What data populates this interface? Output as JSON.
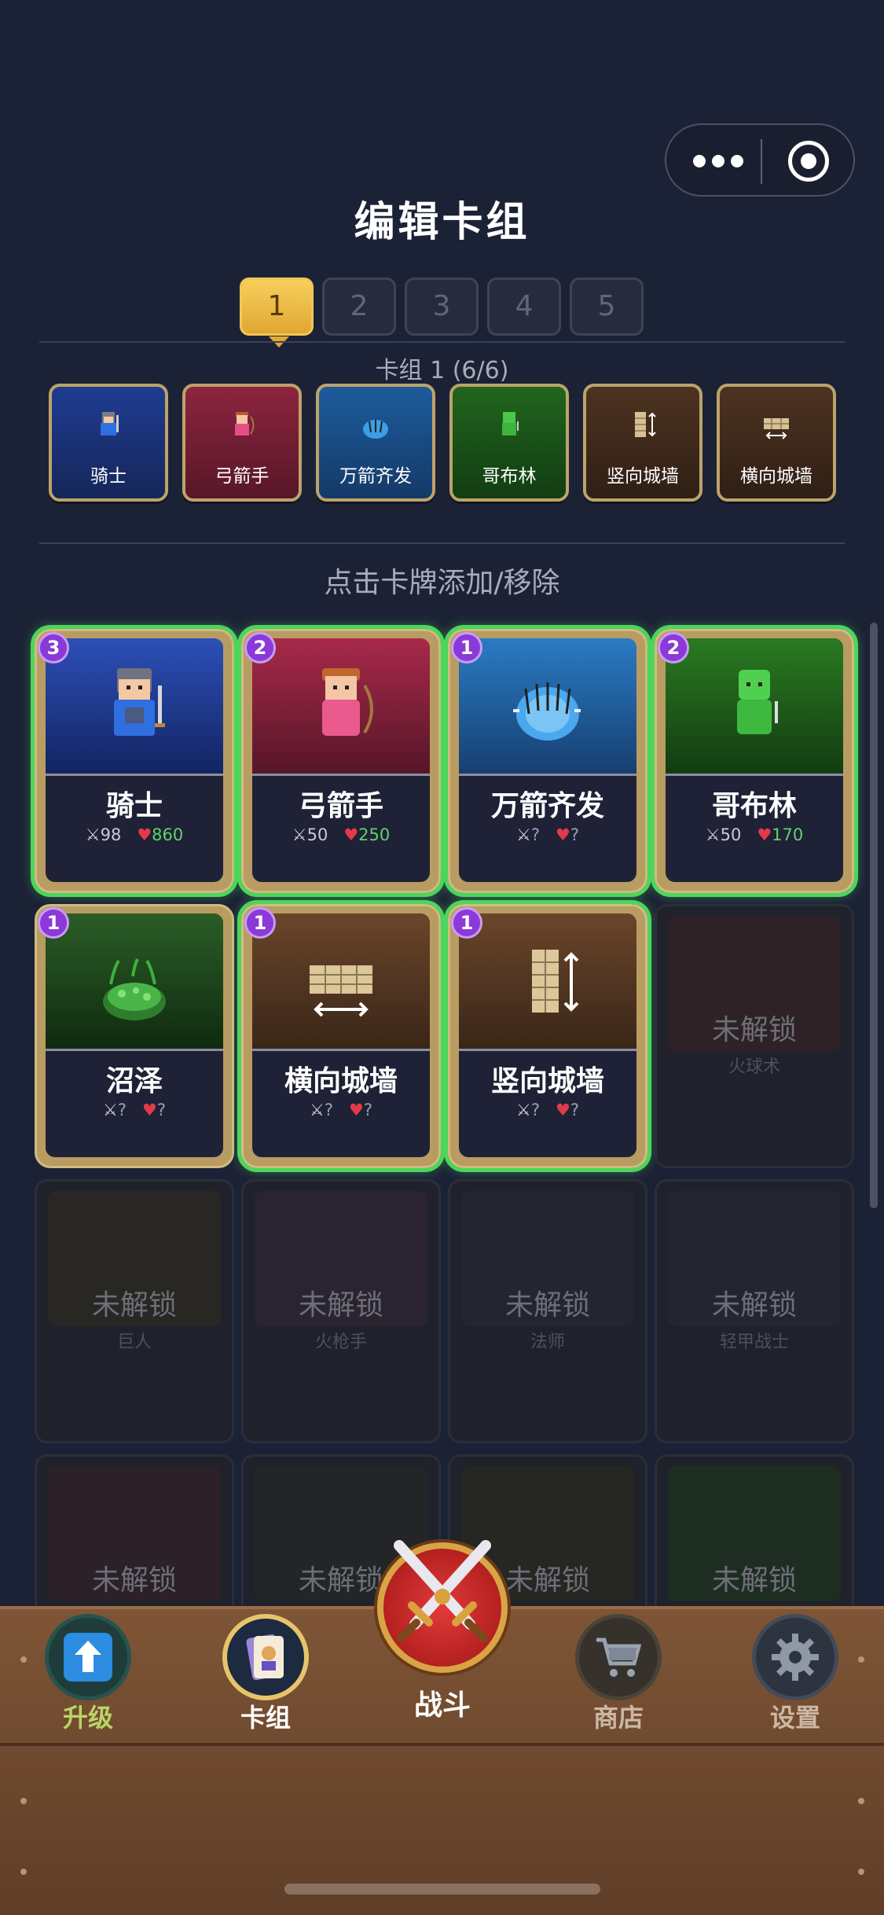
{
  "header": {
    "title": "编辑卡组"
  },
  "deck_tabs": [
    "1",
    "2",
    "3",
    "4",
    "5"
  ],
  "active_deck": "1",
  "deck_label": "卡组 1 (6/6)",
  "selected_cards": [
    "骑士",
    "弓箭手",
    "万箭齐发",
    "哥布林",
    "竖向城墙",
    "横向城墙"
  ],
  "hint": "点击卡牌添加/移除",
  "cards": [
    {
      "name": "骑士",
      "count": "3",
      "atk": "98",
      "hp": "860"
    },
    {
      "name": "弓箭手",
      "count": "2",
      "atk": "50",
      "hp": "250"
    },
    {
      "name": "万箭齐发",
      "count": "1",
      "atk": "?",
      "hp": "?"
    },
    {
      "name": "哥布林",
      "count": "2",
      "atk": "50",
      "hp": "170"
    },
    {
      "name": "沼泽",
      "count": "1",
      "atk": "?",
      "hp": "?"
    },
    {
      "name": "横向城墙",
      "count": "1",
      "atk": "?",
      "hp": "?"
    },
    {
      "name": "竖向城墙",
      "count": "1",
      "atk": "?",
      "hp": "?"
    }
  ],
  "locked_label": "未解锁",
  "locked_cards": [
    "火球术",
    "巨人",
    "火枪手",
    "法师",
    "轻甲战士"
  ],
  "nav": {
    "upgrade": "升级",
    "deck": "卡组",
    "battle": "战斗",
    "shop": "商店",
    "settings": "设置"
  },
  "colors": {
    "accent": "#f3c655",
    "selected_glow": "#4bd65c",
    "badge": "#8b39d8",
    "bg": "#1c2236"
  }
}
